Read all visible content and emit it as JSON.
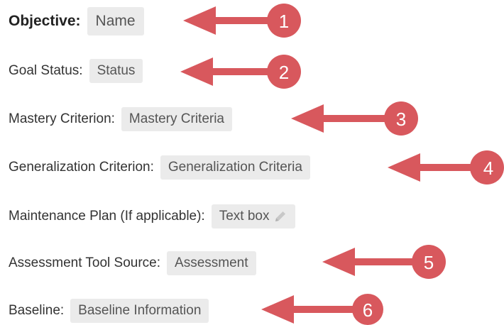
{
  "fields": [
    {
      "label": "Objective:",
      "value": "Name"
    },
    {
      "label": "Goal Status:",
      "value": "Status"
    },
    {
      "label": "Mastery Criterion:",
      "value": "Mastery Criteria"
    },
    {
      "label": "Generalization Criterion:",
      "value": "Generalization Criteria"
    },
    {
      "label": "Maintenance Plan (If applicable):",
      "value": "Text box"
    },
    {
      "label": "Assessment Tool Source:",
      "value": "Assessment"
    },
    {
      "label": "Baseline:",
      "value": "Baseline Information"
    }
  ],
  "callouts": [
    "1",
    "2",
    "3",
    "4",
    "5",
    "6"
  ],
  "colors": {
    "arrow": "#d8585d",
    "field_bg": "#ebebeb",
    "label_text": "#333333",
    "field_text": "#555555"
  },
  "icons": {
    "edit": "pencil-icon"
  }
}
